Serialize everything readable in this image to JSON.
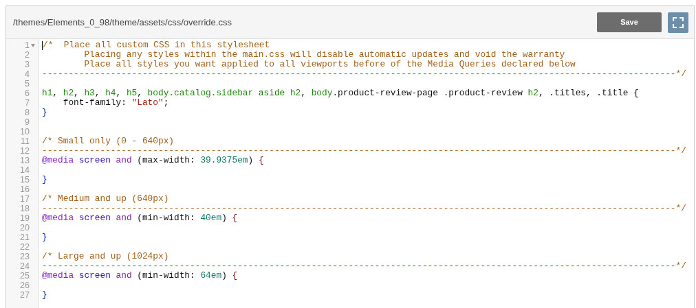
{
  "header": {
    "path": "/themes/Elements_0_98/theme/assets/css/override.css",
    "save_label": "Save"
  },
  "editor": {
    "lines": [
      {
        "number": "1",
        "foldable": true,
        "cursor": true,
        "tokens": [
          {
            "kind": "comment",
            "text": "/*  Place all custom CSS in this stylesheet"
          }
        ]
      },
      {
        "number": "2",
        "foldable": false,
        "cursor": false,
        "tokens": [
          {
            "kind": "comment",
            "text": "        Placing any styles within the main.css will disable automatic updates and void the warranty"
          }
        ]
      },
      {
        "number": "3",
        "foldable": false,
        "cursor": false,
        "tokens": [
          {
            "kind": "comment",
            "text": "        Place all styles you want applied to all viewports before of the Media Queries declared below"
          }
        ]
      },
      {
        "number": "4",
        "foldable": false,
        "cursor": false,
        "tokens": [
          {
            "kind": "comment",
            "text": "------------------------------------------------------------------------------------------------------------------------*/"
          }
        ]
      },
      {
        "number": "5",
        "foldable": false,
        "cursor": false
      },
      {
        "number": "6",
        "foldable": false,
        "cursor": false,
        "tokens": [
          {
            "kind": "tag",
            "text": "h1"
          },
          {
            "kind": "plain",
            "text": ", "
          },
          {
            "kind": "tag",
            "text": "h2"
          },
          {
            "kind": "plain",
            "text": ", "
          },
          {
            "kind": "tag",
            "text": "h3"
          },
          {
            "kind": "plain",
            "text": ", "
          },
          {
            "kind": "tag",
            "text": "h4"
          },
          {
            "kind": "plain",
            "text": ", "
          },
          {
            "kind": "tag",
            "text": "h5"
          },
          {
            "kind": "plain",
            "text": ", "
          },
          {
            "kind": "tag",
            "text": "body.catalog.sidebar"
          },
          {
            "kind": "tag2",
            "text": " aside"
          },
          {
            "kind": "tag",
            "text": " h2"
          },
          {
            "kind": "plain",
            "text": ", "
          },
          {
            "kind": "tag",
            "text": "body"
          },
          {
            "kind": "plain",
            "text": ".product-review-page .product-review "
          },
          {
            "kind": "tag",
            "text": "h2"
          },
          {
            "kind": "plain",
            "text": ", .titles, .title {"
          }
        ]
      },
      {
        "number": "7",
        "foldable": false,
        "cursor": false,
        "tokens": [
          {
            "kind": "plain",
            "text": "    font-family: "
          },
          {
            "kind": "string",
            "text": "\"Lato\""
          },
          {
            "kind": "plain",
            "text": ";"
          }
        ]
      },
      {
        "number": "8",
        "foldable": false,
        "cursor": false,
        "tokens": [
          {
            "kind": "bracket",
            "text": "}"
          }
        ]
      },
      {
        "number": "9",
        "foldable": false,
        "cursor": false
      },
      {
        "number": "10",
        "foldable": false,
        "cursor": false
      },
      {
        "number": "11",
        "foldable": false,
        "cursor": false,
        "tokens": [
          {
            "kind": "comment",
            "text": "/* Small only (0 - 640px)"
          }
        ]
      },
      {
        "number": "12",
        "foldable": false,
        "cursor": false,
        "tokens": [
          {
            "kind": "comment",
            "text": "------------------------------------------------------------------------------------------------------------------------*/"
          }
        ]
      },
      {
        "number": "13",
        "foldable": false,
        "cursor": false,
        "tokens": [
          {
            "kind": "def",
            "text": "@media"
          },
          {
            "kind": "attribute",
            "text": " screen"
          },
          {
            "kind": "keyword",
            "text": " and"
          },
          {
            "kind": "plain",
            "text": " (max-width: "
          },
          {
            "kind": "number",
            "text": "39.9375em"
          },
          {
            "kind": "plain",
            "text": ") "
          },
          {
            "kind": "brace",
            "text": "{"
          }
        ]
      },
      {
        "number": "14",
        "foldable": false,
        "cursor": false
      },
      {
        "number": "15",
        "foldable": false,
        "cursor": false,
        "tokens": [
          {
            "kind": "bracket",
            "text": "}"
          }
        ]
      },
      {
        "number": "16",
        "foldable": false,
        "cursor": false
      },
      {
        "number": "17",
        "foldable": false,
        "cursor": false,
        "tokens": [
          {
            "kind": "comment",
            "text": "/* Medium and up (640px)"
          }
        ]
      },
      {
        "number": "18",
        "foldable": false,
        "cursor": false,
        "tokens": [
          {
            "kind": "comment",
            "text": "------------------------------------------------------------------------------------------------------------------------*/"
          }
        ]
      },
      {
        "number": "19",
        "foldable": false,
        "cursor": false,
        "tokens": [
          {
            "kind": "def",
            "text": "@media"
          },
          {
            "kind": "attribute",
            "text": " screen"
          },
          {
            "kind": "keyword",
            "text": " and"
          },
          {
            "kind": "plain",
            "text": " (min-width: "
          },
          {
            "kind": "number",
            "text": "40em"
          },
          {
            "kind": "plain",
            "text": ") "
          },
          {
            "kind": "brace",
            "text": "{"
          }
        ]
      },
      {
        "number": "20",
        "foldable": false,
        "cursor": false
      },
      {
        "number": "21",
        "foldable": false,
        "cursor": false,
        "tokens": [
          {
            "kind": "bracket",
            "text": "}"
          }
        ]
      },
      {
        "number": "22",
        "foldable": false,
        "cursor": false
      },
      {
        "number": "23",
        "foldable": false,
        "cursor": false,
        "tokens": [
          {
            "kind": "comment",
            "text": "/* Large and up (1024px)"
          }
        ]
      },
      {
        "number": "24",
        "foldable": false,
        "cursor": false,
        "tokens": [
          {
            "kind": "comment",
            "text": "------------------------------------------------------------------------------------------------------------------------*/"
          }
        ]
      },
      {
        "number": "25",
        "foldable": false,
        "cursor": false,
        "tokens": [
          {
            "kind": "def",
            "text": "@media"
          },
          {
            "kind": "attribute",
            "text": " screen"
          },
          {
            "kind": "keyword",
            "text": " and"
          },
          {
            "kind": "plain",
            "text": " (min-width: "
          },
          {
            "kind": "number",
            "text": "64em"
          },
          {
            "kind": "plain",
            "text": ") "
          },
          {
            "kind": "brace",
            "text": "{"
          }
        ]
      },
      {
        "number": "26",
        "foldable": false,
        "cursor": false
      },
      {
        "number": "27",
        "foldable": false,
        "cursor": false,
        "tokens": [
          {
            "kind": "bracket",
            "text": "}"
          }
        ]
      }
    ]
  }
}
